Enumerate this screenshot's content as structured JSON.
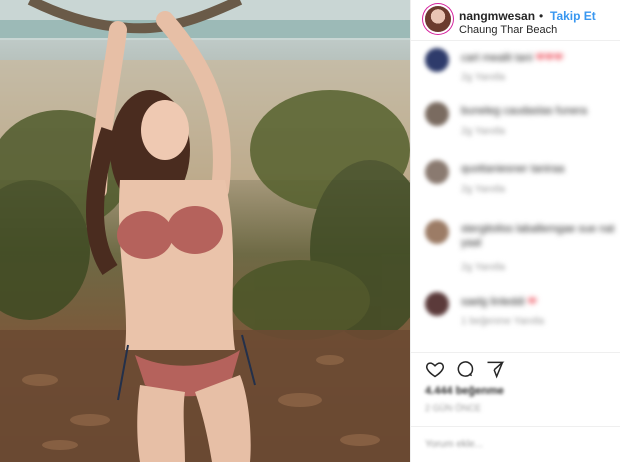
{
  "post": {
    "username": "nangmwesan",
    "separator": "•",
    "follow_label": "Takip Et",
    "location": "Chaung Thar Beach"
  },
  "comments": [
    {
      "text": "cart mealit tani",
      "hearts": "❤❤❤",
      "meta": "2g   Yanıtla",
      "avatar_color": "#2e3b6b"
    },
    {
      "text": "buneleg caudaslas funera",
      "hearts": "",
      "meta": "2g   Yanıtla",
      "avatar_color": "#7a6b60"
    },
    {
      "text": "quottaniesner taniraa",
      "hearts": "",
      "meta": "2g   Yanıtla",
      "avatar_color": "#8a7a70"
    },
    {
      "text": "stergitoliss laballemgae sue nat",
      "text2": "yaal",
      "hearts": "",
      "meta": "2g   Yanıtla",
      "avatar_color": "#9c7c66"
    },
    {
      "text": "saelg linleddi",
      "hearts": "❤",
      "meta": "1 beğenme   Yanıtla",
      "avatar_color": "#5b3a3a"
    }
  ],
  "actions": {
    "like_icon": "heart-icon",
    "comment_icon": "comment-icon",
    "share_icon": "share-icon"
  },
  "likes_text": "4.444 beğenme",
  "date_text": "2 GÜN ÖNCE",
  "add_comment_placeholder": "Yorum ekle..."
}
